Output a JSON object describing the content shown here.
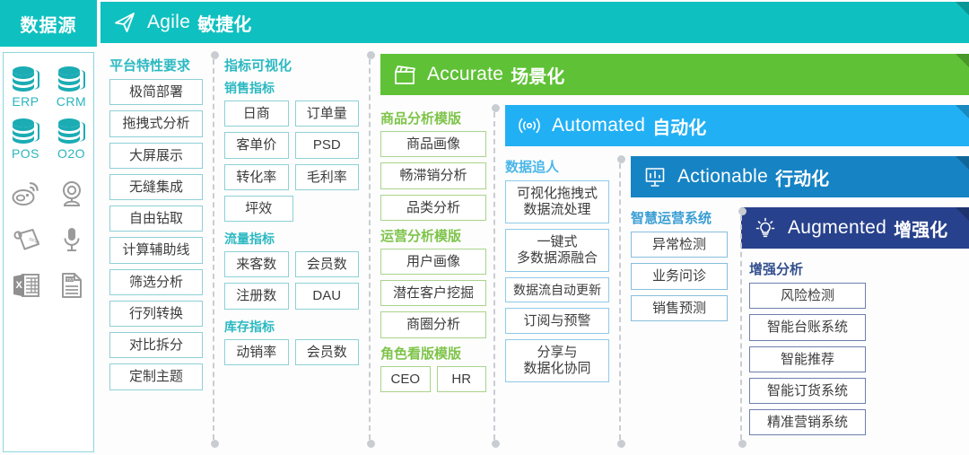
{
  "datasource": {
    "title": "数据源",
    "databases": [
      {
        "label": "ERP",
        "icon": "database-icon"
      },
      {
        "label": "CRM",
        "icon": "database-icon"
      },
      {
        "label": "POS",
        "icon": "database-icon"
      },
      {
        "label": "O2O",
        "icon": "database-icon"
      }
    ],
    "channels": [
      {
        "icon": "weibo-icon"
      },
      {
        "icon": "webcam-icon"
      },
      {
        "icon": "rfid-tag-icon"
      },
      {
        "icon": "microphone-icon"
      },
      {
        "icon": "excel-file-icon"
      },
      {
        "icon": "text-file-icon"
      }
    ]
  },
  "banners": [
    {
      "id": "agile",
      "en": "Agile",
      "cn": "敏捷化",
      "icon": "paper-plane-icon",
      "color": "#0fc0c0"
    },
    {
      "id": "accurate",
      "en": "Accurate",
      "cn": "场景化",
      "icon": "clapperboard-icon",
      "color": "#5fc236"
    },
    {
      "id": "automated",
      "en": "Automated",
      "cn": "自动化",
      "icon": "signal-waves-icon",
      "color": "#22b0f4"
    },
    {
      "id": "actionable",
      "en": "Actionable",
      "cn": "行动化",
      "icon": "bar-chart-icon",
      "color": "#1683c4"
    },
    {
      "id": "augmented",
      "en": "Augmented",
      "cn": "增强化",
      "icon": "lightbulb-icon",
      "color": "#27418c"
    }
  ],
  "columns": {
    "platform": {
      "title": "平台特性要求",
      "chips": [
        "极简部署",
        "拖拽式分析",
        "大屏展示",
        "无缝集成",
        "自由钻取",
        "计算辅助线",
        "筛选分析",
        "行列转换",
        "对比拆分",
        "定制主题"
      ]
    },
    "metrics": {
      "title": "指标可视化",
      "groups": [
        {
          "title": "销售指标",
          "rows": [
            [
              "日商",
              "订单量"
            ],
            [
              "客单价",
              "PSD"
            ],
            [
              "转化率",
              "毛利率"
            ],
            [
              "坪效"
            ]
          ]
        },
        {
          "title": "流量指标",
          "rows": [
            [
              "来客数",
              "会员数"
            ],
            [
              "注册数",
              "DAU"
            ]
          ]
        },
        {
          "title": "库存指标",
          "rows": [
            [
              "动销率",
              "会员数"
            ]
          ]
        }
      ]
    },
    "scenario": {
      "groups": [
        {
          "title": "商品分析模版",
          "rows": [
            [
              "商品画像"
            ],
            [
              "畅滞销分析"
            ],
            [
              "品类分析"
            ]
          ]
        },
        {
          "title": "运营分析模版",
          "rows": [
            [
              "用户画像"
            ],
            [
              "潜在客户挖掘"
            ],
            [
              "商圈分析"
            ]
          ]
        },
        {
          "title": "角色看版模版",
          "rows": [
            [
              "CEO",
              "HR"
            ]
          ]
        }
      ]
    },
    "datachase": {
      "title": "数据追人",
      "chips": [
        {
          "lines": [
            "可视化拖拽式",
            "数据流处理"
          ]
        },
        {
          "lines": [
            "一键式",
            "多数据源融合"
          ]
        },
        {
          "lines": [
            "数据流自动更新"
          ]
        },
        {
          "lines": [
            "订阅与预警"
          ]
        },
        {
          "lines": [
            "分享与",
            "数据化协同"
          ]
        }
      ]
    },
    "smartops": {
      "title": "智慧运营系统",
      "chips": [
        "异常检测",
        "业务问诊",
        "销售预测"
      ]
    },
    "augmented": {
      "title": "增强分析",
      "chips": [
        "风险检测",
        "智能台账系统",
        "智能推荐",
        "智能订货系统",
        "精准营销系统"
      ]
    }
  }
}
